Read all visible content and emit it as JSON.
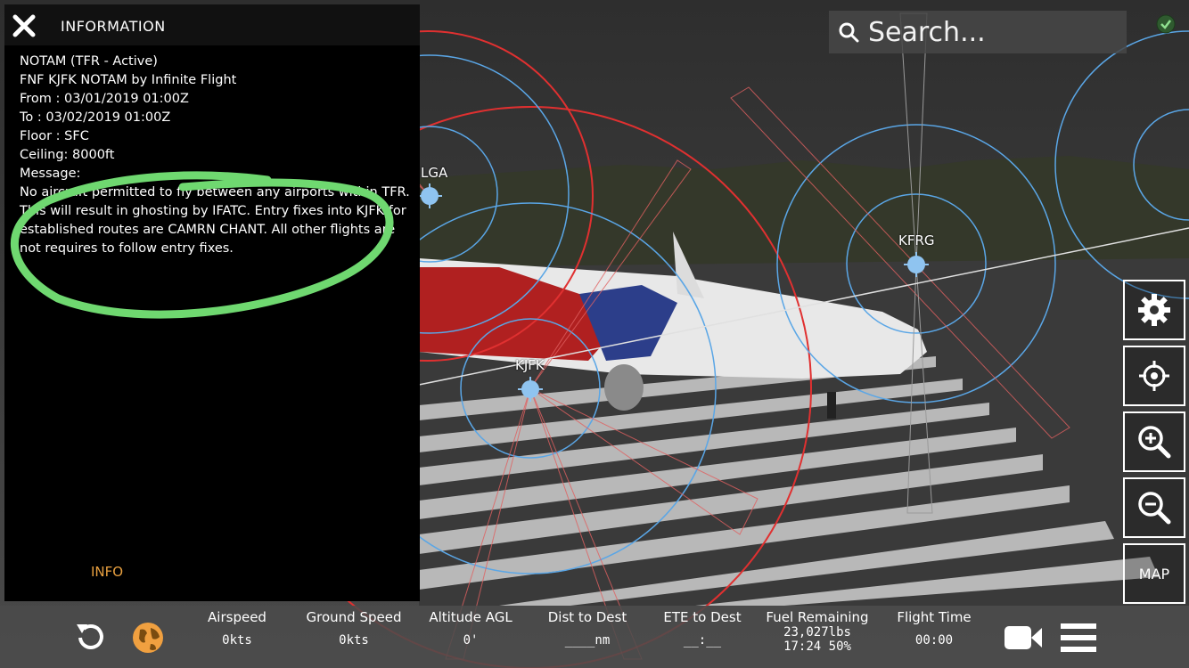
{
  "info_panel": {
    "title": "INFORMATION",
    "lines": [
      "NOTAM (TFR - Active)",
      "FNF KJFK NOTAM by Infinite Flight",
      "From   : 03/01/2019 01:00Z",
      "To      : 03/02/2019 01:00Z",
      "Floor  : SFC",
      "Ceiling: 8000ft",
      "Message:"
    ],
    "message": "No aircraft permitted to fly between any airports within TFR. This will result in ghosting by IFATC. Entry fixes into KJFK for established routes are CAMRN CHANT. All other flights are not requires to follow entry fixes.",
    "tab_label": "INFO",
    "tab_color": "#e8a040",
    "annotation_color": "#6fd870"
  },
  "search": {
    "placeholder": "Search..."
  },
  "map": {
    "airports": [
      "LGA",
      "KJFK",
      "KFRG"
    ],
    "tfr_ring_color": "#e03030",
    "airport_ring_color": "#5aa6e6"
  },
  "side_buttons": {
    "settings": "gear-icon",
    "locate": "crosshair-icon",
    "zoom_in": "zoom-in-icon",
    "zoom_out": "zoom-out-icon",
    "map_label": "MAP"
  },
  "bottom_bar": {
    "stats": [
      {
        "label": "Airspeed",
        "value": "0kts"
      },
      {
        "label": "Ground Speed",
        "value": "0kts"
      },
      {
        "label": "Altitude AGL",
        "value": "0'"
      },
      {
        "label": "Dist to Dest",
        "value": "____nm"
      },
      {
        "label": "ETE to Dest",
        "value": "__:__"
      },
      {
        "label": "Fuel Remaining",
        "value": "23,027lbs",
        "value2": "17:24 50%"
      },
      {
        "label": "Flight Time",
        "value": "00:00"
      }
    ],
    "globe_color": "#f0a040"
  }
}
